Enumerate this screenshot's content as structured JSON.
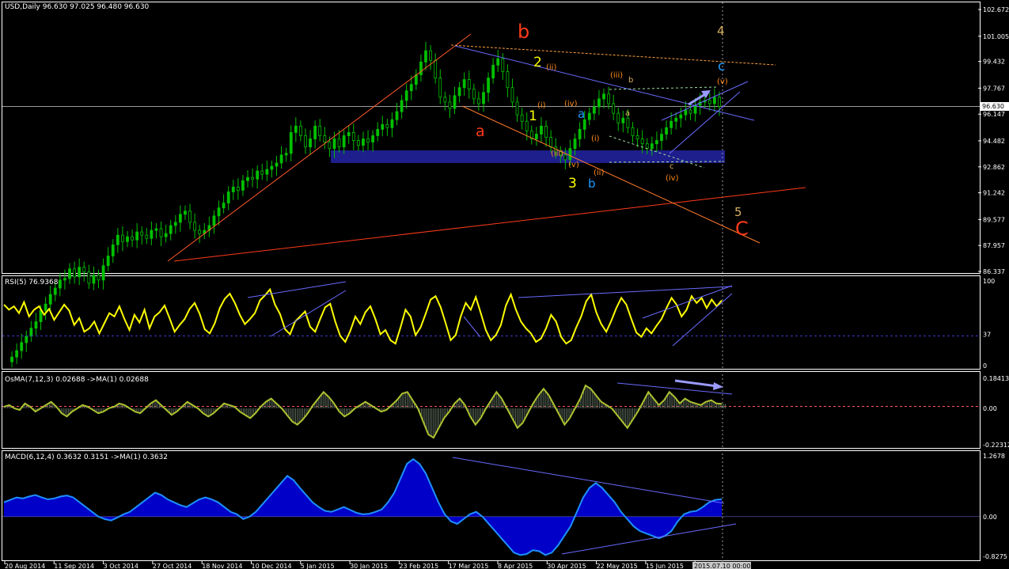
{
  "colors": {
    "background": "#000000",
    "grid_frame": "#ffffff",
    "candle": "#00c000",
    "rsi": "#ffff00",
    "osma_line": "#adc12e",
    "osma_hist": "#607060",
    "macd_hist": "#0000e0",
    "macd_line": "#1e90ff",
    "trend_blue": "#6a6aff",
    "trend_orange": "#ff6a2a",
    "trend_red": "#ff3a1a",
    "zone": "#1e1e8c",
    "label_red": "#ff3a1a",
    "label_yellow": "#ffff00",
    "label_cyan": "#1e9bff",
    "label_orange": "#ff8c1a",
    "label_tan": "#d8b060"
  },
  "chart_data": [
    {
      "type": "candlestick",
      "title": "USD,Daily  96.630 97.025 96.480 96.630",
      "symbol": "USD",
      "timeframe": "Daily",
      "ohlc_header": "96.630 97.025 96.480 96.630",
      "current_price": "96.630",
      "ylim": [
        86.337,
        102.672
      ],
      "y_ticks": [
        "102.672",
        "101.005",
        "99.432",
        "97.767",
        "96.147",
        "94.482",
        "92.862",
        "91.242",
        "89.577",
        "87.957",
        "86.337"
      ],
      "x_labels": [
        "20 Aug 2014",
        "11 Sep 2014",
        "3 Oct 2014",
        "27 Oct 2014",
        "18 Nov 2014",
        "10 Dec 2014",
        "5 Jan 2015",
        "30 Jan 2015",
        "23 Feb 2015",
        "17 Mar 2015",
        "8 Apr 2015",
        "30 Apr 2015",
        "22 May 2015",
        "15 Jun 2015",
        "2015.07.10 00:00"
      ],
      "closes": [
        81.0,
        81.4,
        81.9,
        82.3,
        82.8,
        83.2,
        83.9,
        84.3,
        84.9,
        85.3,
        85.8,
        85.9,
        86.5,
        86.0,
        86.6,
        86.3,
        85.6,
        86.1,
        85.8,
        86.7,
        87.3,
        88.0,
        88.6,
        88.2,
        88.5,
        88.3,
        88.8,
        88.6,
        88.4,
        88.9,
        89.0,
        88.5,
        88.7,
        89.2,
        89.4,
        89.9,
        90.1,
        89.4,
        88.9,
        88.7,
        88.9,
        89.2,
        89.8,
        90.3,
        90.6,
        91.3,
        91.6,
        91.4,
        92.0,
        92.2,
        92.1,
        92.6,
        92.4,
        92.7,
        92.9,
        93.1,
        93.6,
        93.7,
        95.0,
        95.4,
        94.8,
        94.1,
        94.6,
        95.4,
        94.8,
        94.4,
        94.0,
        94.6,
        94.1,
        94.8,
        95.0,
        94.5,
        94.2,
        94.6,
        94.4,
        94.8,
        95.2,
        95.5,
        95.3,
        95.8,
        96.3,
        97.0,
        97.6,
        98.0,
        98.6,
        99.4,
        100.1,
        99.5,
        98.4,
        97.2,
        96.9,
        96.5,
        97.3,
        97.8,
        98.3,
        97.7,
        97.1,
        96.8,
        97.5,
        98.4,
        99.2,
        99.6,
        98.8,
        97.8,
        96.9,
        96.1,
        95.7,
        95.1,
        94.6,
        94.9,
        95.4,
        94.7,
        94.1,
        93.8,
        93.6,
        93.3,
        94.0,
        94.6,
        95.2,
        95.8,
        96.2,
        96.6,
        97.1,
        97.4,
        96.8,
        96.2,
        95.6,
        95.9,
        95.3,
        94.8,
        94.6,
        94.3,
        94.0,
        94.3,
        94.5,
        94.9,
        95.3,
        95.7,
        95.9,
        96.1,
        96.4,
        96.2,
        96.7,
        96.9,
        97.0,
        96.8,
        97.2,
        96.63
      ],
      "ohlc_series": {
        "name": "USD",
        "type": "candles"
      }
    },
    {
      "type": "line",
      "title": "RSI(5) 76.9368",
      "ylim": [
        0,
        100
      ],
      "y_ticks": [
        "100",
        "37",
        "0"
      ],
      "level": 37,
      "values": [
        72,
        66,
        70,
        62,
        75,
        58,
        66,
        70,
        60,
        67,
        54,
        63,
        72,
        65,
        48,
        56,
        40,
        44,
        52,
        38,
        50,
        62,
        58,
        70,
        55,
        42,
        60,
        51,
        66,
        44,
        58,
        63,
        71,
        56,
        40,
        48,
        55,
        67,
        74,
        61,
        43,
        38,
        50,
        68,
        79,
        85,
        74,
        60,
        49,
        55,
        62,
        77,
        83,
        90,
        72,
        61,
        43,
        37,
        52,
        58,
        64,
        46,
        40,
        55,
        69,
        73,
        52,
        35,
        28,
        41,
        58,
        49,
        63,
        70,
        55,
        37,
        42,
        30,
        26,
        45,
        66,
        58,
        36,
        45,
        61,
        78,
        82,
        69,
        50,
        30,
        36,
        58,
        74,
        66,
        81,
        62,
        42,
        30,
        36,
        48,
        71,
        84,
        66,
        52,
        44,
        38,
        28,
        32,
        44,
        60,
        52,
        34,
        26,
        30,
        45,
        58,
        76,
        84,
        63,
        49,
        40,
        53,
        68,
        80,
        72,
        55,
        39,
        34,
        44,
        38,
        47,
        55,
        68,
        80,
        72,
        58,
        66,
        82,
        74,
        80,
        68,
        78,
        70,
        77
      ]
    },
    {
      "type": "line",
      "title": "OsMA(7,12,3) 0.02688  ->MA(1) 0.02688",
      "ylim": [
        -0.22312,
        0.18413
      ],
      "y_ticks": [
        "0.18413",
        "0.00",
        "-0.22312"
      ],
      "values": [
        0.01,
        0.02,
        0.0,
        -0.01,
        0.03,
        0.01,
        -0.02,
        0.0,
        0.02,
        0.04,
        0.01,
        -0.03,
        -0.05,
        -0.02,
        0.0,
        0.02,
        0.01,
        -0.01,
        -0.03,
        -0.02,
        0.0,
        0.01,
        0.03,
        0.02,
        0.0,
        -0.02,
        -0.03,
        0.0,
        0.03,
        0.05,
        0.02,
        -0.01,
        -0.04,
        -0.02,
        0.01,
        0.04,
        0.02,
        0.0,
        -0.03,
        -0.05,
        -0.03,
        0.0,
        0.03,
        0.02,
        0.01,
        -0.02,
        -0.04,
        -0.06,
        -0.03,
        0.01,
        0.04,
        0.06,
        0.03,
        0.0,
        -0.04,
        -0.08,
        -0.1,
        -0.07,
        -0.03,
        0.02,
        0.06,
        0.1,
        0.07,
        0.03,
        -0.02,
        -0.05,
        -0.03,
        0.0,
        0.02,
        0.04,
        0.02,
        0.0,
        -0.02,
        -0.01,
        0.02,
        0.05,
        0.09,
        0.1,
        0.05,
        0.0,
        -0.08,
        -0.16,
        -0.18,
        -0.12,
        -0.06,
        -0.02,
        0.03,
        0.06,
        0.02,
        -0.05,
        -0.1,
        -0.06,
        0.0,
        0.05,
        0.1,
        0.06,
        0.0,
        -0.06,
        -0.12,
        -0.09,
        -0.03,
        0.03,
        0.08,
        0.12,
        0.08,
        0.02,
        -0.04,
        -0.1,
        -0.06,
        0.0,
        0.06,
        0.14,
        0.12,
        0.08,
        0.04,
        0.02,
        0.0,
        -0.04,
        -0.08,
        -0.12,
        -0.07,
        -0.02,
        0.04,
        0.1,
        0.06,
        0.02,
        0.05,
        0.1,
        0.07,
        0.03,
        0.06,
        0.04,
        0.03,
        0.02,
        0.04,
        0.05,
        0.03,
        0.027
      ]
    },
    {
      "type": "area",
      "title": "MACD(6,12,4) 0.3632 0.3151  ->MA(1) 0.3632",
      "ylim": [
        -0.8275,
        1.2678
      ],
      "y_ticks": [
        "1.2678",
        "0.00",
        "-0.8275"
      ],
      "values": [
        0.3,
        0.35,
        0.4,
        0.38,
        0.42,
        0.45,
        0.4,
        0.36,
        0.38,
        0.42,
        0.44,
        0.4,
        0.3,
        0.2,
        0.1,
        0.0,
        -0.05,
        -0.08,
        -0.02,
        0.05,
        0.1,
        0.2,
        0.3,
        0.4,
        0.5,
        0.45,
        0.36,
        0.3,
        0.24,
        0.2,
        0.28,
        0.36,
        0.4,
        0.36,
        0.3,
        0.2,
        0.1,
        0.05,
        -0.05,
        0.0,
        0.1,
        0.25,
        0.4,
        0.55,
        0.7,
        0.85,
        0.76,
        0.6,
        0.45,
        0.3,
        0.2,
        0.12,
        0.1,
        0.15,
        0.2,
        0.14,
        0.08,
        0.05,
        0.06,
        0.1,
        0.15,
        0.3,
        0.5,
        0.8,
        1.1,
        1.2,
        1.1,
        0.9,
        0.6,
        0.3,
        0.05,
        -0.1,
        -0.15,
        -0.05,
        0.05,
        0.1,
        0.0,
        -0.15,
        -0.3,
        -0.45,
        -0.6,
        -0.75,
        -0.8,
        -0.78,
        -0.7,
        -0.72,
        -0.8,
        -0.75,
        -0.6,
        -0.4,
        -0.2,
        0.1,
        0.4,
        0.6,
        0.7,
        0.6,
        0.45,
        0.3,
        0.1,
        -0.05,
        -0.2,
        -0.3,
        -0.35,
        -0.4,
        -0.45,
        -0.4,
        -0.3,
        -0.1,
        0.05,
        0.1,
        0.12,
        0.2,
        0.3,
        0.35,
        0.3632
      ]
    }
  ],
  "wave_labels": [
    {
      "text": "b",
      "color": "label_red",
      "size": "large"
    },
    {
      "text": "a",
      "color": "label_red",
      "size": "large"
    },
    {
      "text": "C",
      "color": "label_red",
      "size": "large"
    },
    {
      "text": "2",
      "color": "label_yellow",
      "size": "medium"
    },
    {
      "text": "1",
      "color": "label_yellow",
      "size": "medium"
    },
    {
      "text": "3",
      "color": "label_yellow",
      "size": "medium"
    },
    {
      "text": "4",
      "color": "label_tan",
      "size": "medium"
    },
    {
      "text": "5",
      "color": "label_tan",
      "size": "medium"
    },
    {
      "text": "a",
      "color": "label_cyan",
      "size": "medium"
    },
    {
      "text": "b",
      "color": "label_cyan",
      "size": "medium"
    },
    {
      "text": "c",
      "color": "label_cyan",
      "size": "medium"
    },
    {
      "text": "(ii)",
      "color": "label_orange",
      "size": "small"
    },
    {
      "text": "(i)",
      "color": "label_orange",
      "size": "small"
    },
    {
      "text": "(iv)",
      "color": "label_orange",
      "size": "small"
    },
    {
      "text": "(iii)",
      "color": "label_orange",
      "size": "small"
    },
    {
      "text": "(v)",
      "color": "label_orange",
      "size": "small"
    },
    {
      "text": "(i)",
      "color": "label_orange",
      "size": "small"
    },
    {
      "text": "(ii)",
      "color": "label_orange",
      "size": "small"
    },
    {
      "text": "(iii)",
      "color": "label_orange",
      "size": "small"
    },
    {
      "text": "(iv)",
      "color": "label_orange",
      "size": "small"
    },
    {
      "text": "(v)",
      "color": "label_orange",
      "size": "small"
    },
    {
      "text": "b",
      "color": "label_tan",
      "size": "small"
    },
    {
      "text": "a",
      "color": "label_tan",
      "size": "small"
    },
    {
      "text": "c",
      "color": "label_tan",
      "size": "small"
    }
  ]
}
